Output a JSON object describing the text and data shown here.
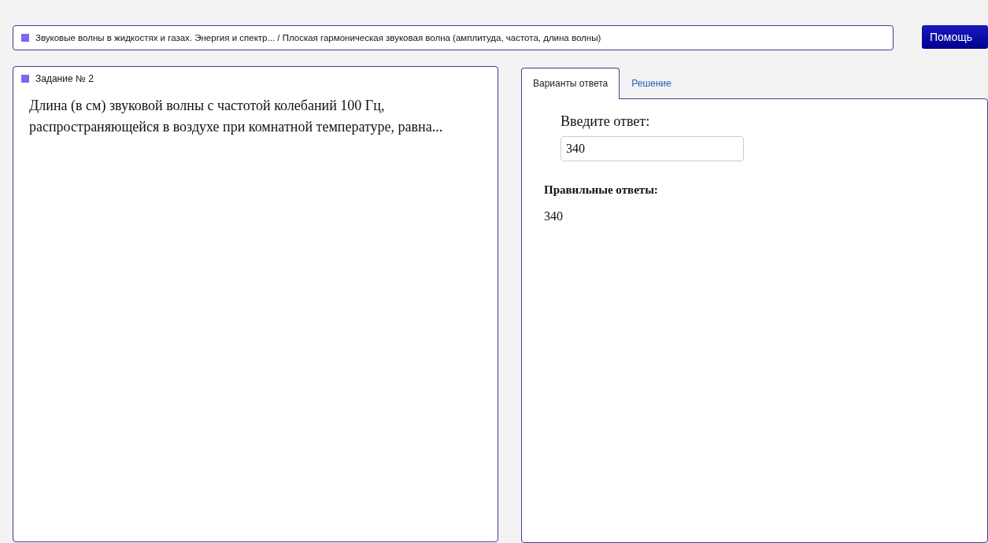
{
  "breadcrumb": {
    "text": "Звуковые волны в жидкостях и газах. Энергия и спектр... / Плоская гармоническая звуковая волна (амплитуда, частота, длина волны)"
  },
  "help_button": "Помощь",
  "task": {
    "title": "Задание № 2",
    "question": "Длина (в см) звуковой волны с частотой колебаний 100 Гц, распространяющейся в воздухе при комнатной температуре, равна..."
  },
  "tabs": [
    {
      "label": "Варианты ответа",
      "selected": true
    },
    {
      "label": "Решение",
      "selected": false
    }
  ],
  "answer": {
    "label": "Введите ответ:",
    "value": "340",
    "correct_heading": "Правильные ответы:",
    "correct_value": "340"
  }
}
